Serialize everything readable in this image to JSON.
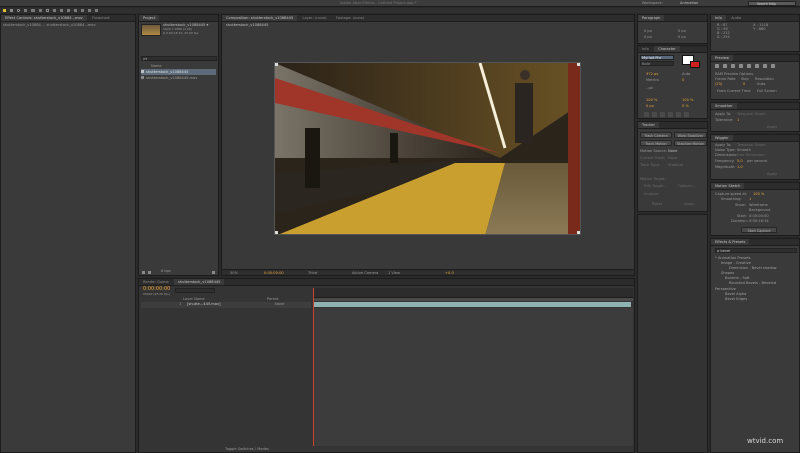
{
  "menubar": {
    "app_title": "Adobe After Effects - Untitled Project.aep *",
    "workspace_label": "Workspace:",
    "workspace_value": "Animation",
    "search_placeholder": "Search Help"
  },
  "left_panel": {
    "tabs": [
      "Effect Controls: shutterstock_v10884...mov",
      "Flowchart"
    ],
    "breadcrumb": "shutterstock_v10884 ... shutterstock_v10884...mov"
  },
  "project_panel": {
    "tab": "Project",
    "item_name": "shutterstock_v1088445 ▾",
    "item_info": [
      "1920 x 1080 (1.00)",
      "Δ 0:00:18:15, 25.00 fps"
    ],
    "search_value": "ρ▾",
    "column_name": "Name",
    "items": [
      "shutterstock_v1088445",
      "shutterstock_v1088445.mov"
    ],
    "bpc": "8 bpc"
  },
  "composition": {
    "tabs": [
      "Composition: shutterstock_v1088445",
      "Layer: (none)",
      "Footage: (none)"
    ],
    "sub_tab": "shutterstock_v1088445",
    "zoom": "50%",
    "timecode": "0:00:00:00",
    "resolution": "Third",
    "camera": "Active Camera",
    "views": "1 View",
    "exposure": "+0.0"
  },
  "timeline": {
    "tabs": [
      "Render Queue",
      "shutterstock_v1088445"
    ],
    "current_time": "0:00:00:00",
    "fps_info": "00000 (25.00 fps)",
    "columns": [
      "Layer Name",
      "Parent"
    ],
    "layer_index": "1",
    "layer_name": "[shutte...445.mov]",
    "layer_parent": "None",
    "footer": "Toggle Switches / Modes"
  },
  "paragraph_panel": {
    "tab": "Paragraph",
    "values": [
      "0 px",
      "0 px",
      "0 px",
      "0 px",
      "0 px"
    ]
  },
  "character_panel": {
    "tabs": [
      "Info",
      "Character"
    ],
    "font": "Myriad Pro",
    "style": "Bold",
    "size": "372 px",
    "leading": "Auto",
    "kerning": "Metrics",
    "tracking": "0",
    "stroke": "- px",
    "vert_scale": "100 %",
    "horiz_scale": "100 %",
    "baseline": "0 px",
    "tsume": "0 %"
  },
  "tracker_panel": {
    "tab": "Tracker",
    "buttons": [
      "Track Camera",
      "Warp Stabilizer",
      "Track Motion",
      "Stabilize Motion"
    ],
    "motion_source_label": "Motion Source:",
    "motion_source_value": "None",
    "rows": [
      "Current Track:",
      "Track Type:",
      "Motion Target:"
    ],
    "row_values": [
      "None",
      "Stabilize",
      ""
    ],
    "options": [
      "Edit Target...",
      "Options..."
    ],
    "analyze_label": "Analyze:",
    "footer_buttons": [
      "Reset",
      "Apply"
    ]
  },
  "info_panel": {
    "tabs": [
      "Info",
      "Audio"
    ],
    "lines": [
      "R : 87",
      "G : 95",
      "B : 212",
      "A : 255"
    ],
    "coords": [
      "X : 1118",
      "Y : 860"
    ]
  },
  "preview_panel": {
    "tab": "Preview",
    "ram_preview": "RAM Preview Options",
    "frame_rate_label": "Frame Rate",
    "frame_rate": "(25)",
    "skip_label": "Skip",
    "skip": "0",
    "resolution_label": "Resolution",
    "resolution": "Auto",
    "from_current": "From Current Time",
    "full_screen": "Full Screen"
  },
  "smoother_panel": {
    "tab": "Smoother",
    "apply_to_label": "Apply To:",
    "apply_to": "Temporal Graph",
    "tolerance_label": "Tolerance:",
    "tolerance": "1",
    "apply_button": "Apply"
  },
  "wiggler_panel": {
    "tab": "Wiggler",
    "apply_to_label": "Apply To:",
    "apply_to": "Temporal Graph",
    "noise_label": "Noise Type:",
    "noise": "Smooth",
    "dimensions_label": "Dimensions:",
    "dimensions": "One Dimension",
    "frequency_label": "Frequency:",
    "frequency": "5.0",
    "frequency_unit": "per second",
    "magnitude_label": "Magnitude:",
    "magnitude": "1.0",
    "apply_button": "Apply"
  },
  "motion_sketch_panel": {
    "tab": "Motion Sketch",
    "capture_label": "Capture speed at:",
    "capture": "100 %",
    "smoothing_label": "Smoothing:",
    "smoothing": "1",
    "show_label": "Show:",
    "show_options": [
      "Wireframe",
      "Background"
    ],
    "start_label": "Start:",
    "start": "0:00:00:00",
    "duration_label": "Duration:",
    "duration": "0:00:18:14",
    "button": "Start Capture"
  },
  "effects_panel": {
    "tab": "Effects & Presets",
    "search": "ρ bevel",
    "items": [
      "* Animation Presets",
      "Image - Creative",
      "Dimension - Bevel shadow",
      "Shapes",
      "Borders - Soft",
      "Rounded Bevels - Beveled",
      "Perspective",
      "Bevel Alpha",
      "Bevel Edges"
    ]
  },
  "watermark": "wtvid.com"
}
